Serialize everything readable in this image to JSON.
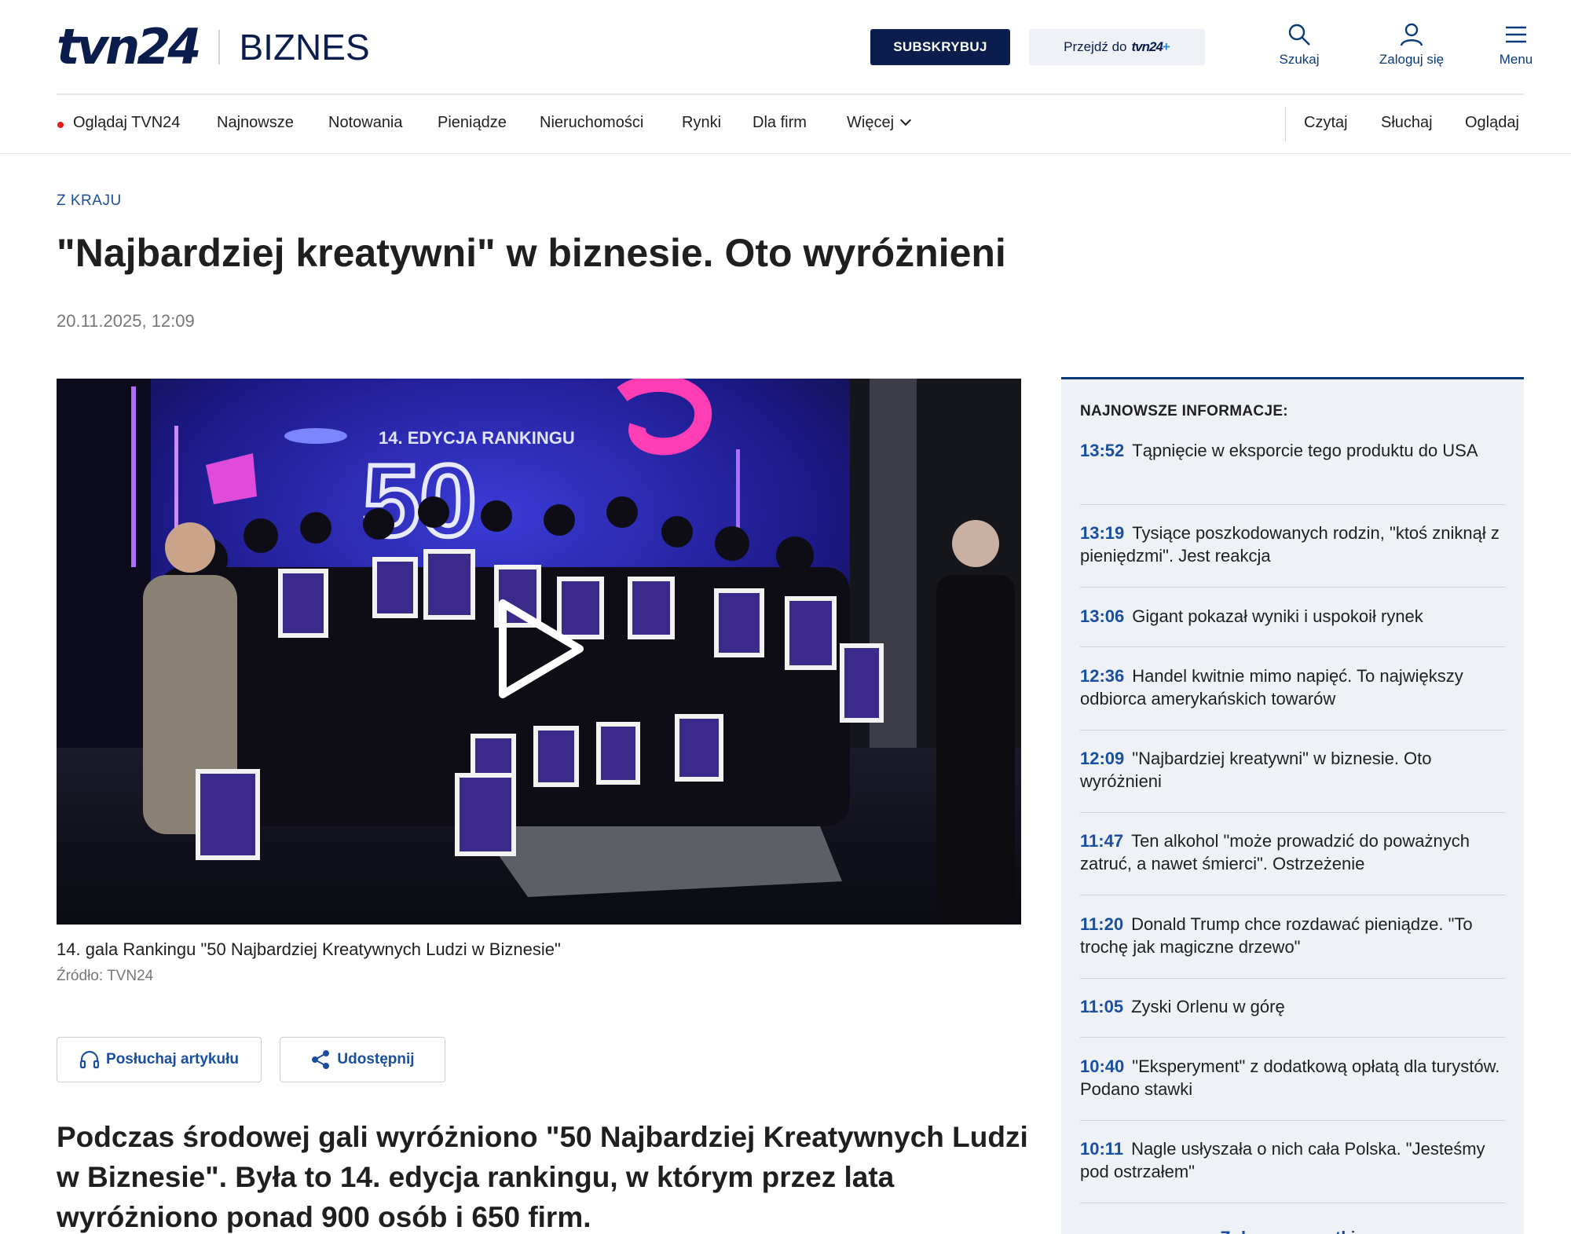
{
  "header": {
    "logo_text": "tvn24",
    "section": "BIZNES",
    "subscribe_label": "SUBSKRYBUJ",
    "goto_label": "Przejdź do",
    "goto_brand": "tvn24",
    "goto_brand_plus": "+",
    "search_label": "Szukaj",
    "login_label": "Zaloguj się",
    "menu_label": "Menu"
  },
  "nav": {
    "live_label": "Oglądaj TVN24",
    "items": [
      "Najnowsze",
      "Notowania",
      "Pieniądze",
      "Nieruchomości",
      "Rynki",
      "Dla firm"
    ],
    "more_label": "Więcej",
    "modes": [
      "Czytaj",
      "Słuchaj",
      "Oglądaj"
    ]
  },
  "article": {
    "category": "Z KRAJU",
    "title": "\"Najbardziej kreatywni\" w biznesie. Oto wyróżnieni",
    "date": "20.11.2025, 12:09",
    "video_screen_text": "14. EDYCJA RANKINGU",
    "video_screen_number": "50",
    "caption": "14. gala Rankingu \"50 Najbardziej Kreatywnych Ludzi w Biznesie\"",
    "source": "Źródło: TVN24",
    "listen_label": "Posłuchaj artykułu",
    "share_label": "Udostępnij",
    "lead": "Podczas środowej gali wyróżniono \"50 Najbardziej Kreatywnych Ludzi w Biznesie\". Była to 14. edycja rankingu, w którym przez lata wyróżniono ponad 900 osób i 650 firm."
  },
  "sidebar": {
    "heading": "NAJNOWSZE INFORMACJE:",
    "items": [
      {
        "time": "13:52",
        "text": "Tąpnięcie w eksporcie tego produktu do USA"
      },
      {
        "time": "13:19",
        "text": "Tysiące poszkodowanych rodzin, \"ktoś zniknął z pieniędzmi\". Jest reakcja"
      },
      {
        "time": "13:06",
        "text": "Gigant pokazał wyniki i uspokoił rynek"
      },
      {
        "time": "12:36",
        "text": "Handel kwitnie mimo napięć. To największy odbiorca amerykańskich towarów"
      },
      {
        "time": "12:09",
        "text": "\"Najbardziej kreatywni\" w biznesie. Oto wyróżnieni"
      },
      {
        "time": "11:47",
        "text": "Ten alkohol \"może prowadzić do poważnych zatruć, a nawet śmierci\". Ostrzeżenie"
      },
      {
        "time": "11:20",
        "text": "Donald Trump chce rozdawać pieniądze. \"To trochę jak magiczne drzewo\""
      },
      {
        "time": "11:05",
        "text": "Zyski Orlenu w górę"
      },
      {
        "time": "10:40",
        "text": "\"Eksperyment\" z dodatkową opłatą dla turystów. Podano stawki"
      },
      {
        "time": "10:11",
        "text": "Nagle usłyszała o nich cała Polska. \"Jesteśmy pod ostrzałem\""
      }
    ],
    "more_label": "Zobacz wszystkie"
  },
  "colors": {
    "brand_navy": "#0b1d4d",
    "link_blue": "#1a4fa0",
    "live_red": "#e21c1c",
    "sidebar_bg": "#eef1f5"
  }
}
